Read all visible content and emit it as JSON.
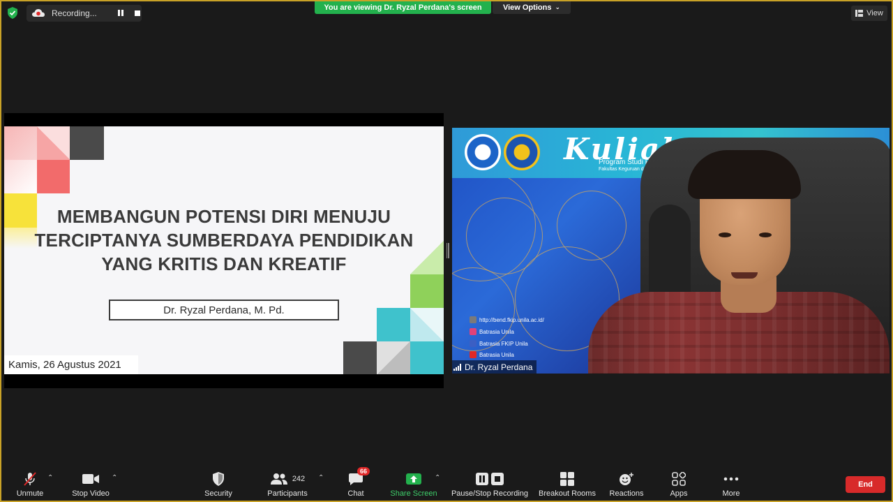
{
  "topbar": {
    "recording_label": "Recording...",
    "viewing_banner": "You are viewing Dr. Ryzal Perdana's screen",
    "view_options_label": "View Options",
    "view_label": "View"
  },
  "slide": {
    "title_line1": "MEMBANGUN POTENSI DIRI MENUJU",
    "title_line2": "TERCIPTANYA SUMBERDAYA PENDIDIKAN",
    "title_line3": "YANG KRITIS DAN KREATIF",
    "author": "Dr. Ryzal Perdana, M. Pd.",
    "date": "Kamis, 26 Agustus 2021"
  },
  "video": {
    "participant_name": "Dr. Ryzal Perdana",
    "banner_title": "Kuliah U",
    "banner_line1": "Program Studi Pendidikan",
    "banner_line2": "Fakultas Keguruan da",
    "social": [
      {
        "text": "http://bend.fkip.unila.ac.id/",
        "color": "#7a7a7a"
      },
      {
        "text": "Batrasia Unila",
        "color": "#e0427a"
      },
      {
        "text": "Batrasia FKIP Unila",
        "color": "#3b5fc4"
      },
      {
        "text": "Batrasia Unila",
        "color": "#e02828"
      }
    ]
  },
  "toolbar": {
    "unmute": "Unmute",
    "stop_video": "Stop Video",
    "security": "Security",
    "participants": "Participants",
    "participants_count": "242",
    "chat": "Chat",
    "chat_badge": "66",
    "share_screen": "Share Screen",
    "pause_stop_recording": "Pause/Stop Recording",
    "breakout_rooms": "Breakout Rooms",
    "reactions": "Reactions",
    "apps": "Apps",
    "more": "More",
    "end": "End"
  },
  "colors": {
    "share_green": "#23b14d",
    "end_red": "#d82a2a",
    "frame_gold": "#c9a227"
  }
}
